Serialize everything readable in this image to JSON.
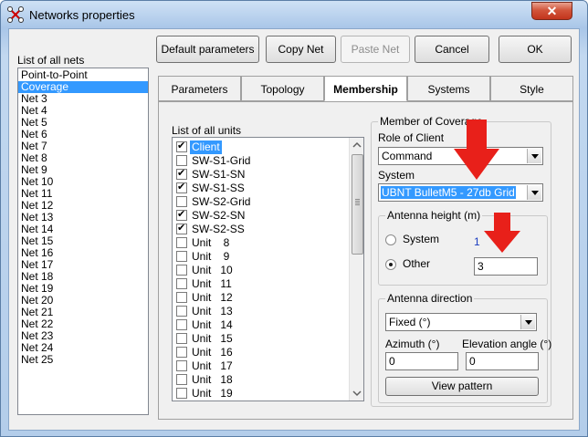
{
  "window": {
    "title": "Networks properties",
    "close_glyph": "✕"
  },
  "toolbar": {
    "default_params": "Default parameters",
    "copy_net": "Copy Net",
    "paste_net": "Paste Net",
    "cancel": "Cancel",
    "ok": "OK"
  },
  "nets": {
    "label": "List of all nets",
    "items": [
      "Point-to-Point",
      "Coverage",
      "Net  3",
      "Net  4",
      "Net  5",
      "Net  6",
      "Net  7",
      "Net  8",
      "Net  9",
      "Net 10",
      "Net 11",
      "Net 12",
      "Net 13",
      "Net 14",
      "Net 15",
      "Net 16",
      "Net 17",
      "Net 18",
      "Net 19",
      "Net 20",
      "Net 21",
      "Net 22",
      "Net 23",
      "Net 24",
      "Net 25"
    ],
    "selected_index": 1
  },
  "tabs": [
    "Parameters",
    "Topology",
    "Membership",
    "Systems",
    "Style"
  ],
  "active_tab": "Membership",
  "units": {
    "label": "List of all units",
    "items": [
      {
        "name": "Client",
        "checked": true
      },
      {
        "name": "SW-S1-Grid",
        "checked": false
      },
      {
        "name": "SW-S1-SN",
        "checked": true
      },
      {
        "name": "SW-S1-SS",
        "checked": true
      },
      {
        "name": "SW-S2-Grid",
        "checked": false
      },
      {
        "name": "SW-S2-SN",
        "checked": true
      },
      {
        "name": "SW-S2-SS",
        "checked": true
      },
      {
        "name": "Unit    8",
        "checked": false
      },
      {
        "name": "Unit    9",
        "checked": false
      },
      {
        "name": "Unit   10",
        "checked": false
      },
      {
        "name": "Unit   11",
        "checked": false
      },
      {
        "name": "Unit   12",
        "checked": false
      },
      {
        "name": "Unit   13",
        "checked": false
      },
      {
        "name": "Unit   14",
        "checked": false
      },
      {
        "name": "Unit   15",
        "checked": false
      },
      {
        "name": "Unit   16",
        "checked": false
      },
      {
        "name": "Unit   17",
        "checked": false
      },
      {
        "name": "Unit   18",
        "checked": false
      },
      {
        "name": "Unit   19",
        "checked": false
      }
    ],
    "selected_index": 0
  },
  "membership": {
    "group_title": "Member of Coverage",
    "role_label": "Role of Client",
    "role_value": "Command",
    "system_label": "System",
    "system_value": "UBNT BulletM5 - 27db Grid",
    "antenna_height": {
      "title": "Antenna height (m)",
      "system_label": "System",
      "system_value": "1",
      "other_label": "Other",
      "other_value": "3",
      "selected": "Other"
    },
    "antenna_direction": {
      "title": "Antenna direction",
      "mode_value": "Fixed (°)",
      "azimuth_label": "Azimuth (°)",
      "azimuth_value": "0",
      "elevation_label": "Elevation angle (°)",
      "elevation_value": "0",
      "view_pattern": "View pattern"
    }
  },
  "colors": {
    "selection": "#3399ff",
    "annotation_arrow": "#e8201a",
    "close_button": "#c94a30"
  }
}
